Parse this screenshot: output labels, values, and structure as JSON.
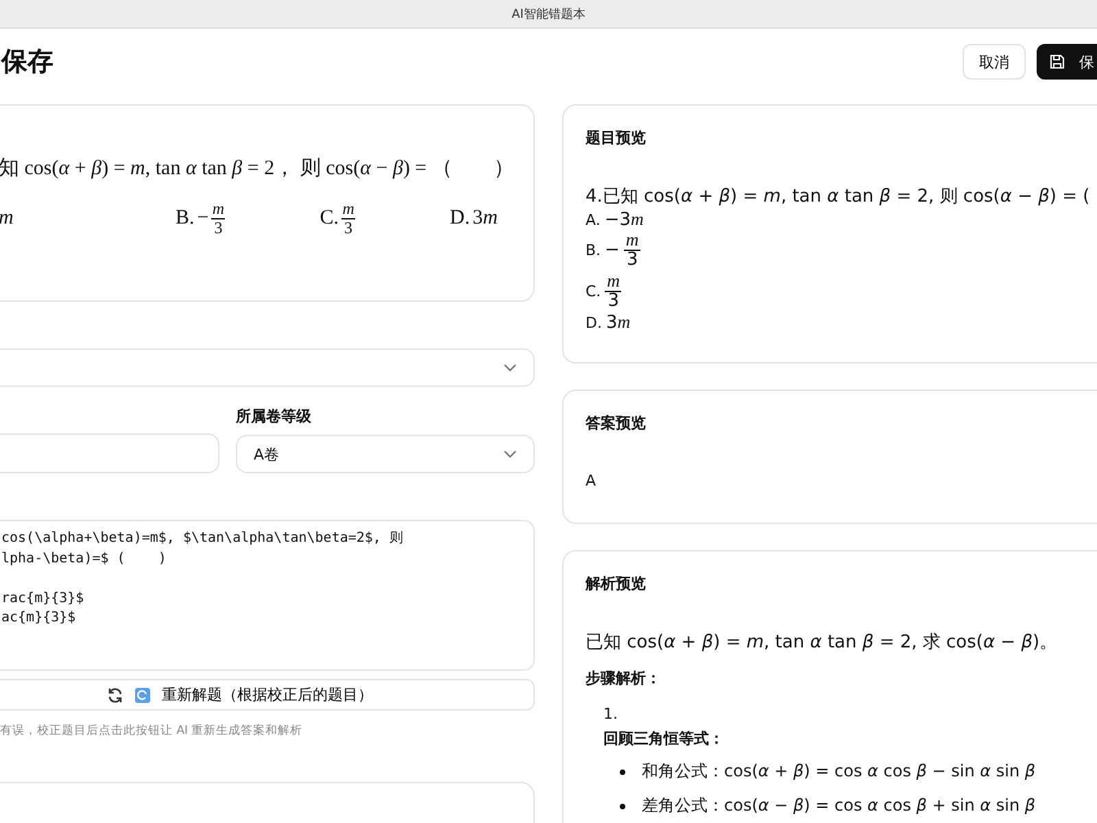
{
  "window": {
    "title": "AI智能错题本"
  },
  "header": {
    "title": "保存",
    "buttons": [
      {
        "label": "取消",
        "kind": "secondary"
      },
      {
        "label": "保",
        "kind": "primary"
      }
    ]
  },
  "scan": {
    "question": "知 cos(*α* + *β*) = *m*, tan *α* tan *β* = 2， 则 cos(*α* − *β*) = （　　）",
    "options": [
      {
        "kind": "term",
        "var": "m"
      },
      {
        "label": "B.",
        "kind": "fraction",
        "sign": "−",
        "num": "m",
        "den": "3"
      },
      {
        "label": "C.",
        "kind": "fraction",
        "num": "m",
        "den": "3"
      },
      {
        "label": "D.",
        "kind": "term",
        "coef": "3",
        "var": "m"
      }
    ]
  },
  "form": {
    "grade_label": "所属卷等级",
    "grade_value": "A卷",
    "editor_lines": [
      "cos(\\alpha+\\beta)=m$, $\\tan\\alpha\\tan\\beta=2$, 则",
      "lpha-\\beta)=$ (    )",
      "rac{m}{3}$",
      "ac{m}{3}$"
    ],
    "resolve_button": "重新解题（根据校正后的题目）",
    "hint": "有误，校正题目后点击此按钮让 AI 重新生成答案和解析"
  },
  "question_preview": {
    "title": "题目预览",
    "question": "4.已知 cos(*α* + *β*) = *m*,  tan *α* tan *β* = 2, 则 cos(*α* − *β*) = (",
    "options": [
      {
        "label": "A.",
        "kind": "term",
        "coef": "−3",
        "var": "m"
      },
      {
        "label": "B.",
        "kind": "fraction",
        "sign": "−",
        "num": "m",
        "den": "3"
      },
      {
        "label": "C.",
        "kind": "fraction",
        "num": "m",
        "den": "3"
      },
      {
        "label": "D.",
        "kind": "term",
        "coef": "3",
        "var": "m"
      }
    ]
  },
  "answer_preview": {
    "title": "答案预览",
    "answer": "A"
  },
  "analysis_preview": {
    "title": "解析预览",
    "intro": "已知 cos(*α* + *β*) = *m*,  tan *α* tan *β* = 2, 求 cos(*α* − *β*)。",
    "steps_title": "步骤解析：",
    "steps": [
      {
        "number": "1.",
        "title": "回顾三角恒等式：",
        "bullets": [
          "和角公式：cos(*α* + *β*) = cos *α* cos *β* − sin *α* sin *β*",
          "差角公式：cos(*α* − *β*) = cos *α* cos *β* + sin *α* sin *β*"
        ]
      }
    ]
  }
}
